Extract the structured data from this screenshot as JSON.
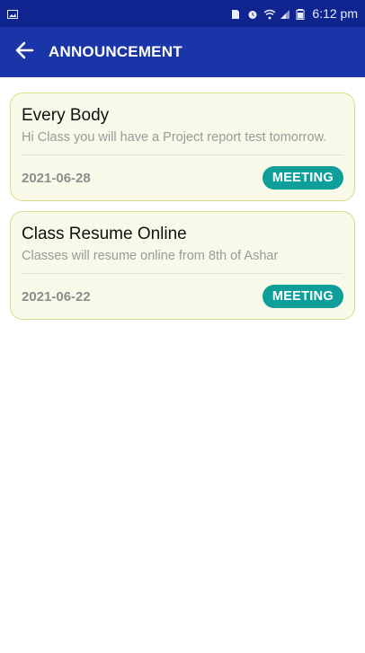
{
  "status_bar": {
    "time": "6:12 pm",
    "icons": [
      "image-icon",
      "sim-icon",
      "alarm-icon",
      "wifi-icon",
      "signal-icon",
      "battery-icon"
    ]
  },
  "app_bar": {
    "title": "ANNOUNCEMENT",
    "back_icon": "arrow-left-icon"
  },
  "announcements": [
    {
      "title": "Every Body",
      "description": "Hi Class you will have a Project report test tomorrow.",
      "date": "2021-06-28",
      "tag": "MEETING"
    },
    {
      "title": "Class Resume Online",
      "description": "Classes will resume online from 8th of Ashar",
      "date": "2021-06-22",
      "tag": "MEETING"
    }
  ],
  "colors": {
    "status_bar": "#0f248f",
    "app_bar": "#1a35a8",
    "card_bg": "#f8f9e8",
    "card_border": "#d9dc8d",
    "badge": "#0e9f9a"
  }
}
